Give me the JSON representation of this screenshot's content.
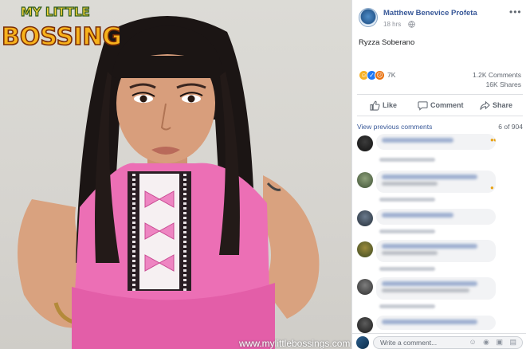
{
  "post": {
    "author": "Matthew Benevice Profeta",
    "time": "18 hrs",
    "more": "•••",
    "caption": "Ryzza Soberano"
  },
  "reactions": {
    "count": "7K",
    "types": [
      "haha-icon",
      "like-icon",
      "angry-icon"
    ]
  },
  "stats": {
    "comments": "1.2K Comments",
    "shares": "16K Shares"
  },
  "actions": {
    "like": "Like",
    "comment": "Comment",
    "share": "Share"
  },
  "comments_section": {
    "view_previous": "View previous comments",
    "count": "6 of 904"
  },
  "write_comment": {
    "placeholder": "Write a comment...",
    "icons": "☺ ◉ ▣ ▤"
  },
  "photo": {
    "watermark_logo_lines": [
      "MY LITTLE",
      "BOSSINGS"
    ],
    "watermark_url": "www.mylittlebossings.com"
  },
  "colors": {
    "link": "#385898",
    "meta": "#606770",
    "dress": "#ec6fb5"
  }
}
